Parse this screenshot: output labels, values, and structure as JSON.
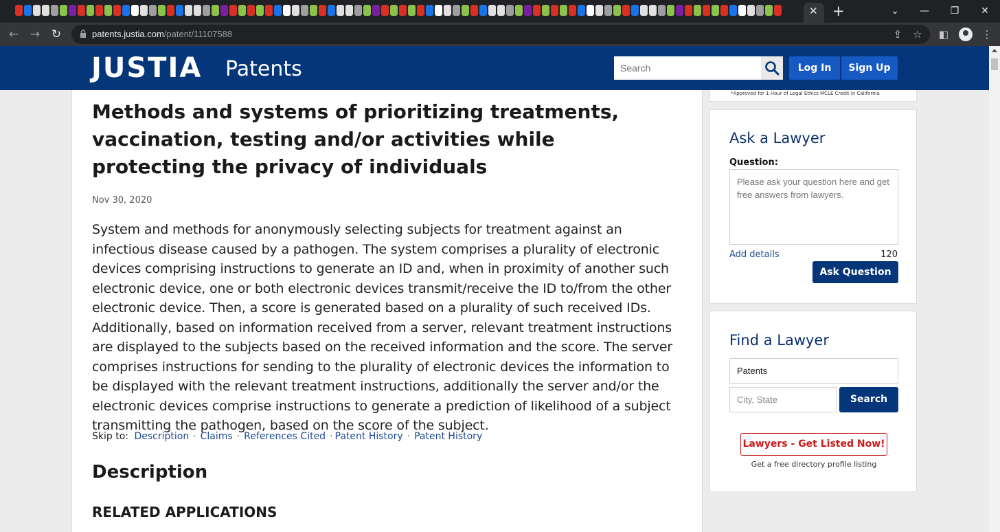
{
  "browser": {
    "url_host": "patents.justia.com",
    "url_path": "/patent/11107588",
    "tab_close": "✕",
    "new_tab": "+"
  },
  "header": {
    "brand": "JUSTIA",
    "brand_sub": "Patents",
    "search_placeholder": "Search",
    "login_label": "Log In",
    "signup_label": "Sign Up"
  },
  "patent": {
    "title": "Methods and systems of prioritizing treatments, vaccination, testing and/or activities while protecting the privacy of individuals",
    "date": "Nov 30, 2020",
    "abstract": "System and methods for anonymously selecting subjects for treatment against an infectious disease caused by a pathogen. The system comprises a plurality of electronic devices comprising instructions to generate an ID and, when in proximity of another such electronic device, one or both electronic devices transmit/receive the ID to/from the other electronic device. Then, a score is generated based on a plurality of such received IDs. Additionally, based on information received from a server, relevant treatment instructions are displayed to the subjects based on the received information and the score. The server comprises instructions for sending to the plurality of electronic devices the information to be displayed with the relevant treatment instructions, additionally the server and/or the electronic devices comprise instructions to generate a prediction of likelihood of a subject transmitting the pathogen, based on the score of the subject.",
    "skip_to_label": "Skip to:",
    "skip_links": [
      "Description",
      "Claims",
      "References Cited",
      "Patent History",
      "Patent History"
    ],
    "description_heading": "Description",
    "related_heading": "RELATED APPLICATIONS"
  },
  "sidebar": {
    "ad_text": "*Approved for 1 Hour of Legal Ethics MCLE Credit in California",
    "ask": {
      "heading": "Ask a Lawyer",
      "question_label": "Question:",
      "question_placeholder": "Please ask your question here and get free answers from lawyers.",
      "add_details": "Add details",
      "char_count": "120",
      "button": "Ask Question"
    },
    "find": {
      "heading": "Find a Lawyer",
      "practice_value": "Patents",
      "location_placeholder": "City, State",
      "button": "Search",
      "listed_button": "Lawyers - Get Listed Now!",
      "listed_sub": "Get a free directory profile listing"
    }
  },
  "colors": {
    "brand_blue": "#05367a",
    "button_blue": "#1659c2",
    "link_blue": "#1e4b92",
    "accent_red": "#c81a1a"
  }
}
